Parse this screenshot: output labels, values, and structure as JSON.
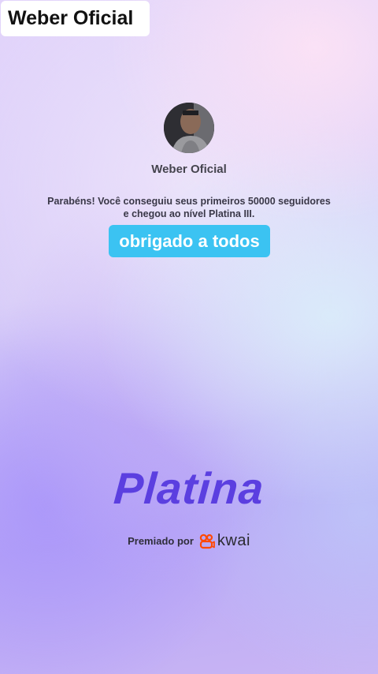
{
  "overlay": {
    "title": "Weber Oficial"
  },
  "profile": {
    "name": "Weber Oficial"
  },
  "message": {
    "line1": "Parabéns! Você conseguiu seus primeiros 50000 seguidores",
    "line2": "e chegou ao nível Platina III."
  },
  "caption": {
    "text": "obrigado a todos"
  },
  "level": {
    "name": "Platina"
  },
  "award": {
    "label": "Premiado por",
    "brand": "kwai",
    "brand_icon": "kwai-logo-icon",
    "brand_color": "#ff4906"
  },
  "colors": {
    "caption_bg": "#3bc3f2",
    "level_text": "#5b3fe0"
  }
}
